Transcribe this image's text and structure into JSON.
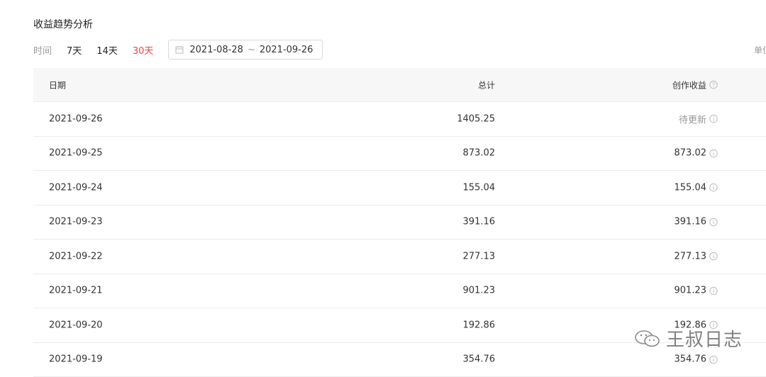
{
  "page": {
    "title": "收益趋势分析",
    "unit_label": "单位"
  },
  "filters": {
    "time_label": "时间",
    "ranges": [
      "7天",
      "14天",
      "30天"
    ],
    "active_range": "30天",
    "date_start": "2021-08-28",
    "date_separator": "~",
    "date_end": "2021-09-26"
  },
  "table": {
    "headers": {
      "date": "日期",
      "total": "总计",
      "income": "创作收益"
    },
    "rows": [
      {
        "date": "2021-09-26",
        "total": "1405.25",
        "income": "待更新",
        "pending": true
      },
      {
        "date": "2021-09-25",
        "total": "873.02",
        "income": "873.02"
      },
      {
        "date": "2021-09-24",
        "total": "155.04",
        "income": "155.04"
      },
      {
        "date": "2021-09-23",
        "total": "391.16",
        "income": "391.16"
      },
      {
        "date": "2021-09-22",
        "total": "277.13",
        "income": "277.13"
      },
      {
        "date": "2021-09-21",
        "total": "901.23",
        "income": "901.23"
      },
      {
        "date": "2021-09-20",
        "total": "192.86",
        "income": "192.86"
      },
      {
        "date": "2021-09-19",
        "total": "354.76",
        "income": "354.76"
      }
    ]
  },
  "watermark": {
    "text": "王叔日志",
    "icon": "wechat-icon"
  },
  "colors": {
    "accent": "#f04142",
    "muted": "#999999",
    "header_bg": "#f7f7f7"
  }
}
